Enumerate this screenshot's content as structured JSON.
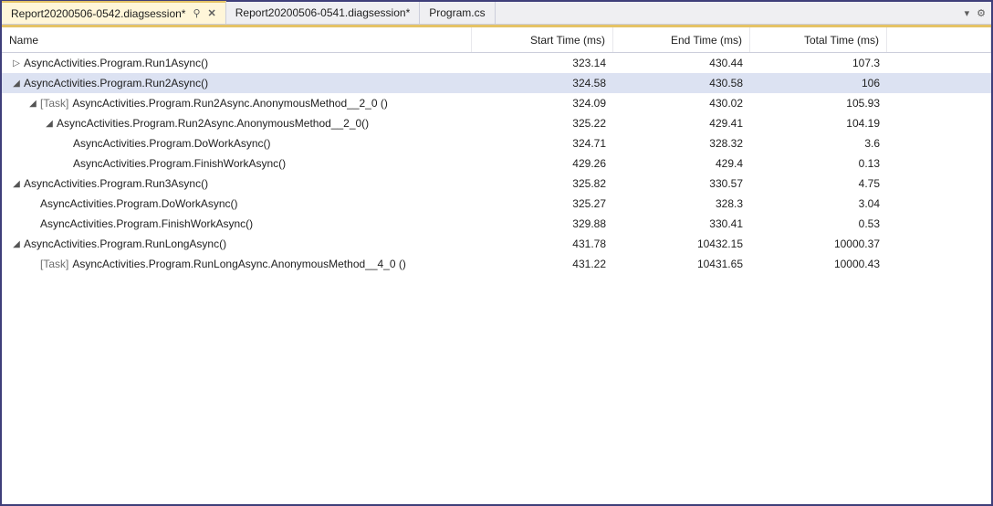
{
  "tabs": [
    {
      "label": "Report20200506-0542.diagsession*",
      "active": true,
      "pinned": true,
      "closeable": true
    },
    {
      "label": "Report20200506-0541.diagsession*",
      "active": false,
      "pinned": false,
      "closeable": false
    },
    {
      "label": "Program.cs",
      "active": false,
      "pinned": false,
      "closeable": false
    }
  ],
  "toolbar_icons": {
    "dropdown": "▾",
    "settings": "⚙"
  },
  "columns": {
    "name": "Name",
    "start": "Start Time (ms)",
    "end": "End Time (ms)",
    "total": "Total Time (ms)"
  },
  "glyphs": {
    "expanded": "◢",
    "collapsed": "▷",
    "pin": "⚲",
    "close": "✕"
  },
  "rows": [
    {
      "depth": 0,
      "glyph": "collapsed",
      "task": false,
      "selected": false,
      "name": "AsyncActivities.Program.Run1Async()",
      "start": "323.14",
      "end": "430.44",
      "total": "107.3"
    },
    {
      "depth": 0,
      "glyph": "expanded",
      "task": false,
      "selected": true,
      "name": "AsyncActivities.Program.Run2Async()",
      "start": "324.58",
      "end": "430.58",
      "total": "106"
    },
    {
      "depth": 1,
      "glyph": "expanded",
      "task": true,
      "selected": false,
      "name": "AsyncActivities.Program.Run2Async.AnonymousMethod__2_0 ()",
      "start": "324.09",
      "end": "430.02",
      "total": "105.93"
    },
    {
      "depth": 2,
      "glyph": "expanded",
      "task": false,
      "selected": false,
      "name": "AsyncActivities.Program.Run2Async.AnonymousMethod__2_0()",
      "start": "325.22",
      "end": "429.41",
      "total": "104.19"
    },
    {
      "depth": 3,
      "glyph": "",
      "task": false,
      "selected": false,
      "name": "AsyncActivities.Program.DoWorkAsync()",
      "start": "324.71",
      "end": "328.32",
      "total": "3.6"
    },
    {
      "depth": 3,
      "glyph": "",
      "task": false,
      "selected": false,
      "name": "AsyncActivities.Program.FinishWorkAsync()",
      "start": "429.26",
      "end": "429.4",
      "total": "0.13"
    },
    {
      "depth": 0,
      "glyph": "expanded",
      "task": false,
      "selected": false,
      "name": "AsyncActivities.Program.Run3Async()",
      "start": "325.82",
      "end": "330.57",
      "total": "4.75"
    },
    {
      "depth": 1,
      "glyph": "",
      "task": false,
      "selected": false,
      "name": "AsyncActivities.Program.DoWorkAsync()",
      "start": "325.27",
      "end": "328.3",
      "total": "3.04"
    },
    {
      "depth": 1,
      "glyph": "",
      "task": false,
      "selected": false,
      "name": "AsyncActivities.Program.FinishWorkAsync()",
      "start": "329.88",
      "end": "330.41",
      "total": "0.53"
    },
    {
      "depth": 0,
      "glyph": "expanded",
      "task": false,
      "selected": false,
      "name": "AsyncActivities.Program.RunLongAsync()",
      "start": "431.78",
      "end": "10432.15",
      "total": "10000.37"
    },
    {
      "depth": 1,
      "glyph": "",
      "task": true,
      "selected": false,
      "name": "AsyncActivities.Program.RunLongAsync.AnonymousMethod__4_0 ()",
      "start": "431.22",
      "end": "10431.65",
      "total": "10000.43"
    }
  ],
  "task_prefix": "[Task]"
}
